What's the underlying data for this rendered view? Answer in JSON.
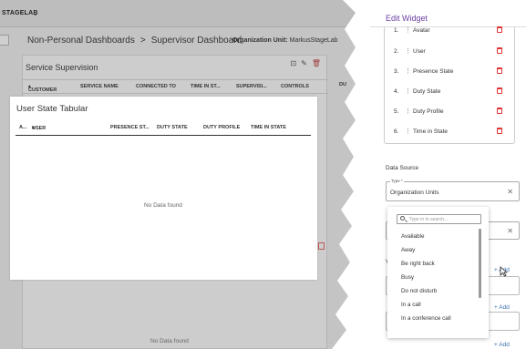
{
  "app": {
    "brand": "STAGELAB"
  },
  "breadcrumb": {
    "part1": "Non-Personal Dashboards",
    "sep": ">",
    "part2": "Supervisor Dashboard"
  },
  "org_unit": {
    "label": "Organization Unit:",
    "value": "MarkusStageLab"
  },
  "service_supervision": {
    "title": "Service Supervision",
    "columns": [
      "CUSTOMER",
      "SERVICE NAME",
      "CONNECTED TO",
      "TIME IN ST...",
      "SUPERVISI...",
      "CONTROLS",
      "DU"
    ],
    "no_data": "No Data found"
  },
  "popup": {
    "title": "User State Tabular",
    "columns": [
      "A...",
      "USER",
      "PRESENCE ST...",
      "DUTY STATE",
      "DUTY PROFILE",
      "TIME IN STATE"
    ],
    "no_data": "No Data found"
  },
  "edit_widget": {
    "title": "Edit Widget",
    "fields": [
      {
        "num": "1.",
        "label": "Avatar"
      },
      {
        "num": "2.",
        "label": "User"
      },
      {
        "num": "3.",
        "label": "Presence State"
      },
      {
        "num": "4.",
        "label": "Duty State"
      },
      {
        "num": "5.",
        "label": "Duty Profile"
      },
      {
        "num": "6.",
        "label": "Time in State"
      }
    ],
    "data_source_label": "Data Source",
    "type_label": "Type *",
    "type_value": "Organization Units",
    "v_label": "V",
    "add_label": "+ Add"
  },
  "dropdown": {
    "search_placeholder": "Type in to search...",
    "options": [
      "Available",
      "Away",
      "Be right back",
      "Busy",
      "Do not disturb",
      "In a call",
      "In a conference call"
    ]
  },
  "colors": {
    "accent": "#6b3fa0",
    "danger": "#dd3333",
    "link": "#3a6fb0"
  }
}
